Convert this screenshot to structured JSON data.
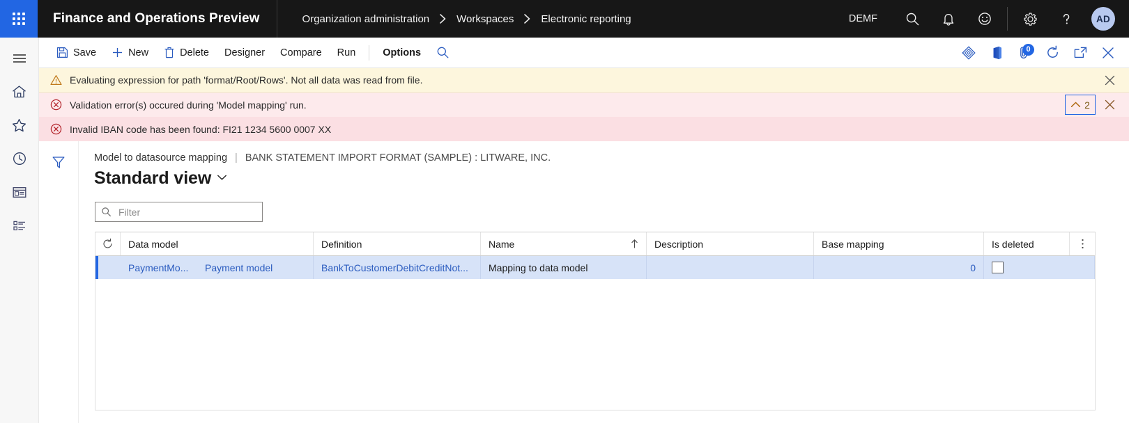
{
  "topnav": {
    "waffle_label": "app-launcher",
    "app_title": "Finance and Operations Preview",
    "breadcrumb": [
      "Organization administration",
      "Workspaces",
      "Electronic reporting"
    ],
    "company": "DEMF",
    "icons": [
      "search-icon",
      "notifications-bell-icon",
      "feedback-smiley-icon",
      "settings-gear-icon",
      "help-question-icon"
    ],
    "avatar_initials": "AD"
  },
  "rail": {
    "items": [
      "hamburger-menu-icon",
      "home-icon",
      "favorites-star-icon",
      "recent-clock-icon",
      "workspaces-icon",
      "modules-list-icon"
    ]
  },
  "commandbar": {
    "save_label": "Save",
    "new_label": "New",
    "delete_label": "Delete",
    "designer_label": "Designer",
    "compare_label": "Compare",
    "run_label": "Run",
    "options_label": "Options",
    "search_icon": "search-icon",
    "right_icons": [
      "personalize-diamond-icon",
      "office-app-icon",
      "attachments-icon",
      "refresh-icon",
      "open-in-new-window-icon",
      "close-icon"
    ],
    "attachments_badge": "0"
  },
  "messages": {
    "warning": {
      "icon": "warning-triangle-icon",
      "text": "Evaluating expression for path 'format/Root/Rows'.   Not all data was read from file."
    },
    "error_main": {
      "icon": "error-circle-icon",
      "text": "Validation error(s) occured during 'Model mapping' run.",
      "collapse_count": "2"
    },
    "error_detail": {
      "icon": "error-circle-icon",
      "text": "Invalid IBAN code has been found: FI21 1234 5600 0007 XX"
    }
  },
  "page": {
    "filter_rail_icon": "filter-funnel-icon",
    "caption_main": "Model to datasource mapping",
    "caption_separator": "|",
    "caption_sub": "BANK STATEMENT IMPORT FORMAT (SAMPLE) : LITWARE, INC.",
    "view_title": "Standard view",
    "view_chevron": "chevron-down-icon",
    "filter": {
      "icon": "search-icon",
      "value": "",
      "placeholder": "Filter"
    },
    "grid": {
      "refresh_icon": "refresh-icon",
      "columns_menu_icon": "column-options-ellipsis-icon",
      "columns": [
        "Data model",
        "Definition",
        "Name",
        "Description",
        "Base mapping",
        "Is deleted"
      ],
      "sorted_column": "Name",
      "sort_direction": "ascending",
      "sort_icon": "sort-ascending-arrow-icon",
      "rows": [
        {
          "data_model_id": "PaymentMo...",
          "data_model_name": "Payment model",
          "definition": "BankToCustomerDebitCreditNot...",
          "name": "Mapping to data model",
          "description": "",
          "base_mapping": "0",
          "is_deleted": false
        }
      ]
    }
  },
  "colors": {
    "accent": "#2266E3",
    "topnav_bg": "#171717",
    "warning_bg": "#fdf6dd",
    "error_bg": "#fdeaec",
    "row_selected_bg": "#d7e3f8"
  }
}
